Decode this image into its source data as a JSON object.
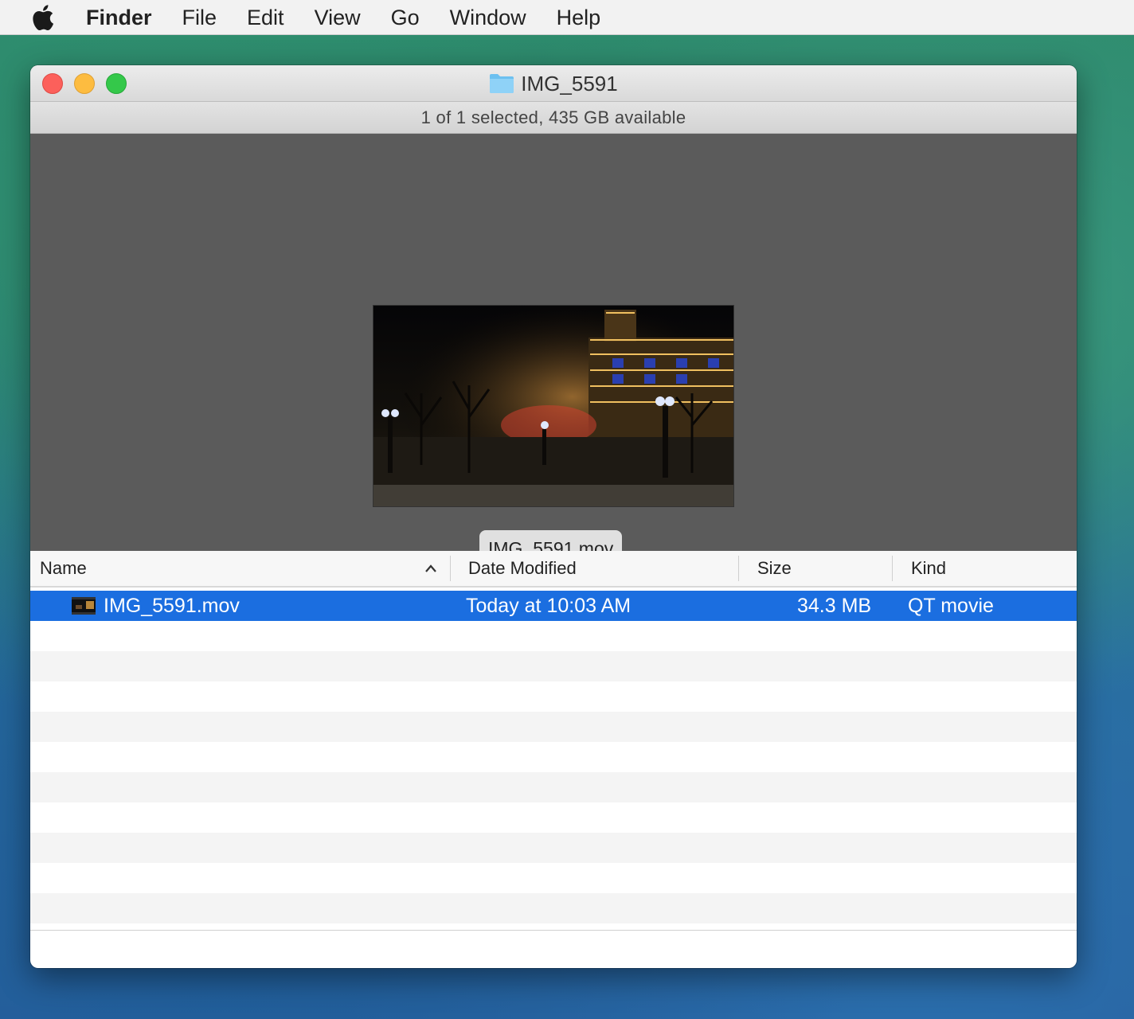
{
  "menubar": {
    "app_name": "Finder",
    "items": [
      "File",
      "Edit",
      "View",
      "Go",
      "Window",
      "Help"
    ]
  },
  "window": {
    "title": "IMG_5591",
    "status": "1 of 1 selected, 435 GB available",
    "preview_label": "IMG_5591.mov"
  },
  "columns": {
    "name": "Name",
    "date": "Date Modified",
    "size": "Size",
    "kind": "Kind"
  },
  "files": [
    {
      "name": "IMG_5591.mov",
      "date": "Today at 10:03 AM",
      "size": "34.3 MB",
      "kind": "QT movie"
    }
  ],
  "colors": {
    "selection": "#1b6ee0",
    "close": "#fc605b",
    "minimize": "#fdbc40",
    "maximize": "#34c84a"
  }
}
